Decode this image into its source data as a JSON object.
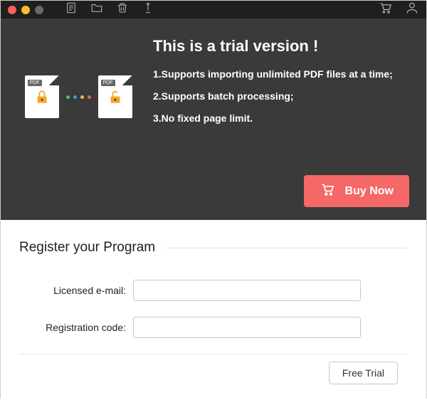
{
  "colors": {
    "accent": "#f46868"
  },
  "titlebar": {
    "icons": [
      "document-icon",
      "folder-icon",
      "trash-icon",
      "pen-icon"
    ],
    "right_icons": [
      "cart-icon",
      "user-icon"
    ]
  },
  "hero": {
    "title": "This is a trial version !",
    "bullets": [
      "1.Supports importing unlimited PDF files at a time;",
      "2.Supports batch processing;",
      "3.No fixed page limit."
    ],
    "pdf_badge": "PDF",
    "buy_label": "Buy Now"
  },
  "register": {
    "heading": "Register your Program",
    "email_label": "Licensed e-mail:",
    "code_label": "Registration code:",
    "email_value": "",
    "code_value": "",
    "free_trial_label": "Free Trial"
  }
}
